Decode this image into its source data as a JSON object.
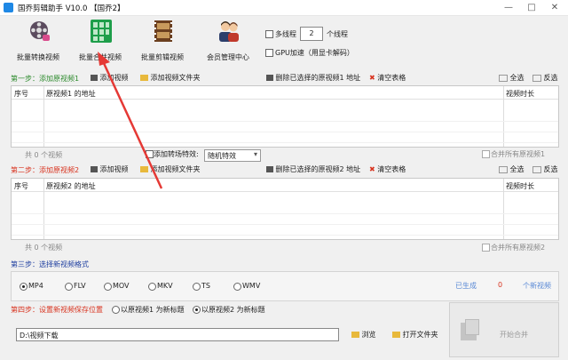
{
  "window": {
    "title": "国乔剪辑助手 V10.0   【国乔2】",
    "min_icon": "minimize-icon",
    "max_icon": "maximize-icon",
    "close_icon": "close-icon"
  },
  "toolbar": {
    "items": [
      {
        "label": "批量转换视频",
        "icon": "film-reel-icon"
      },
      {
        "label": "批量合并视频",
        "icon": "merge-grid-icon"
      },
      {
        "label": "批量剪辑视频",
        "icon": "film-strip-icon"
      },
      {
        "label": "会员管理中心",
        "icon": "users-icon"
      }
    ],
    "multithread_label": "多线程",
    "thread_count": "2",
    "thread_unit": "个线程",
    "gpu_label": "GPU加速（用显卡解码）"
  },
  "step1": {
    "title": "第一步：添加原视频1",
    "add_video": "添加视频",
    "add_folder": "添加视频文件夹",
    "delete_selected": "删除已选择的原视频1 地址",
    "clear_table": "清空表格",
    "select_all": "全选",
    "invert": "反选",
    "col_index": "序号",
    "col_path": "原视频1 的地址",
    "col_duration": "视频时长",
    "count": "共 0 个视频",
    "transition_label": "添加转场特效:",
    "transition_value": "随机特效",
    "merge_all": "合并所有原视频1"
  },
  "step2": {
    "title": "第二步：添加原视频2",
    "add_video": "添加视频",
    "add_folder": "添加视频文件夹",
    "delete_selected": "删除已选择的原视频2 地址",
    "clear_table": "清空表格",
    "select_all": "全选",
    "invert": "反选",
    "col_index": "序号",
    "col_path": "原视频2 的地址",
    "col_duration": "视频时长",
    "count": "共 0 个视频",
    "merge_all": "合并所有原视频2"
  },
  "step3": {
    "title": "第三步：选择新视频格式",
    "formats": [
      "MP4",
      "FLV",
      "MOV",
      "MKV",
      "TS",
      "WMV"
    ],
    "selected": "MP4",
    "generated_label": "已生成",
    "generated_count": "0",
    "generated_unit": "个新视频"
  },
  "step4": {
    "title": "第四步：设置新视频保存位置",
    "option1": "以原视频1 为新标题",
    "option2": "以原视频2 为新标题",
    "selected": "option2",
    "path": "D:\\视频下载",
    "browse": "浏览",
    "open_folder": "打开文件夹",
    "start": "开始合并"
  },
  "colors": {
    "step_green": "#2e8b2e",
    "step_red": "#d8331f",
    "step_blue": "#1f3fa0",
    "arrow": "#e53935"
  }
}
